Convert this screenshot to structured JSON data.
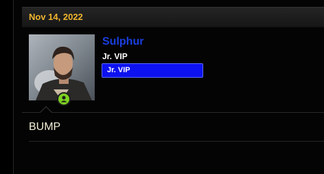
{
  "post": {
    "date": "Nov 14, 2022",
    "message": "BUMP"
  },
  "user": {
    "name": "Sulphur",
    "title": "Jr. VIP",
    "banner": "Jr. VIP",
    "online": true,
    "avatar_icon": "avatar-photo"
  },
  "colors": {
    "date": "#f0b52e",
    "username": "#1a3fe0",
    "banner_bg": "#0d12f0",
    "online": "#7ed321",
    "background": "#000000"
  },
  "icons": {
    "online_status": "user-online-icon"
  }
}
